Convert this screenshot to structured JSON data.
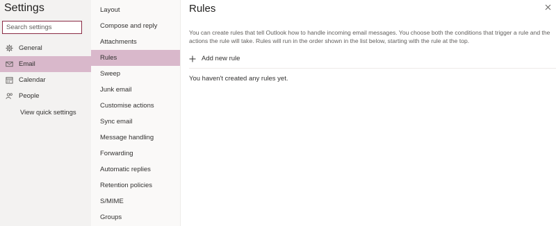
{
  "settings": {
    "title": "Settings",
    "search_placeholder": "Search settings",
    "nav": [
      {
        "label": "General",
        "icon": "gear-icon"
      },
      {
        "label": "Email",
        "icon": "mail-icon",
        "selected": true
      },
      {
        "label": "Calendar",
        "icon": "calendar-icon"
      },
      {
        "label": "People",
        "icon": "people-icon"
      }
    ],
    "quick_settings_label": "View quick settings"
  },
  "email_nav": {
    "items": [
      "Layout",
      "Compose and reply",
      "Attachments",
      "Rules",
      "Sweep",
      "Junk email",
      "Customise actions",
      "Sync email",
      "Message handling",
      "Forwarding",
      "Automatic replies",
      "Retention policies",
      "S/MIME",
      "Groups"
    ],
    "selected": "Rules"
  },
  "rules": {
    "title": "Rules",
    "description": "You can create rules that tell Outlook how to handle incoming email messages. You choose both the conditions that trigger a rule and the actions the rule will take. Rules will run in the order shown in the list below, starting with the rule at the top.",
    "add_label": "Add new rule",
    "empty_text": "You haven't created any rules yet."
  },
  "colors": {
    "selected_bg": "#d9b8cb",
    "search_border": "#8a2a44"
  }
}
